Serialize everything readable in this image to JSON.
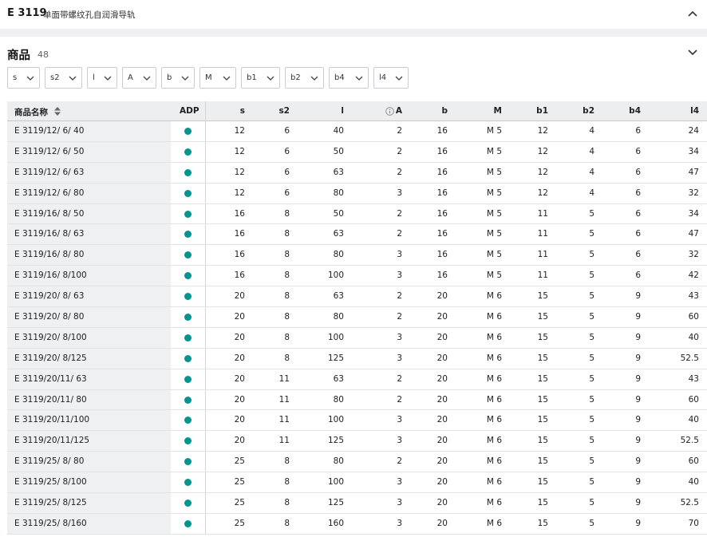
{
  "header": {
    "code": "E 3119",
    "description": "单面带螺纹孔自润滑导轨"
  },
  "section": {
    "title": "商品",
    "count": "48"
  },
  "filters": [
    "s",
    "s2",
    "l",
    "A",
    "b",
    "M",
    "b1",
    "b2",
    "b4",
    "l4"
  ],
  "table": {
    "columns": [
      "商品名称",
      "ADP",
      "s",
      "s2",
      "l",
      "A",
      "b",
      "M",
      "b1",
      "b2",
      "b4",
      "l4"
    ],
    "rows": [
      [
        "E 3119/12/ 6/ 40",
        "12",
        "6",
        "40",
        "2",
        "16",
        "M 5",
        "12",
        "4",
        "6",
        "24"
      ],
      [
        "E 3119/12/ 6/ 50",
        "12",
        "6",
        "50",
        "2",
        "16",
        "M 5",
        "12",
        "4",
        "6",
        "34"
      ],
      [
        "E 3119/12/ 6/ 63",
        "12",
        "6",
        "63",
        "2",
        "16",
        "M 5",
        "12",
        "4",
        "6",
        "47"
      ],
      [
        "E 3119/12/ 6/ 80",
        "12",
        "6",
        "80",
        "3",
        "16",
        "M 5",
        "12",
        "4",
        "6",
        "32"
      ],
      [
        "E 3119/16/ 8/ 50",
        "16",
        "8",
        "50",
        "2",
        "16",
        "M 5",
        "11",
        "5",
        "6",
        "34"
      ],
      [
        "E 3119/16/ 8/ 63",
        "16",
        "8",
        "63",
        "2",
        "16",
        "M 5",
        "11",
        "5",
        "6",
        "47"
      ],
      [
        "E 3119/16/ 8/ 80",
        "16",
        "8",
        "80",
        "3",
        "16",
        "M 5",
        "11",
        "5",
        "6",
        "32"
      ],
      [
        "E 3119/16/ 8/100",
        "16",
        "8",
        "100",
        "3",
        "16",
        "M 5",
        "11",
        "5",
        "6",
        "42"
      ],
      [
        "E 3119/20/ 8/ 63",
        "20",
        "8",
        "63",
        "2",
        "20",
        "M 6",
        "15",
        "5",
        "9",
        "43"
      ],
      [
        "E 3119/20/ 8/ 80",
        "20",
        "8",
        "80",
        "2",
        "20",
        "M 6",
        "15",
        "5",
        "9",
        "60"
      ],
      [
        "E 3119/20/ 8/100",
        "20",
        "8",
        "100",
        "3",
        "20",
        "M 6",
        "15",
        "5",
        "9",
        "40"
      ],
      [
        "E 3119/20/ 8/125",
        "20",
        "8",
        "125",
        "3",
        "20",
        "M 6",
        "15",
        "5",
        "9",
        "52.5"
      ],
      [
        "E 3119/20/11/ 63",
        "20",
        "11",
        "63",
        "2",
        "20",
        "M 6",
        "15",
        "5",
        "9",
        "43"
      ],
      [
        "E 3119/20/11/ 80",
        "20",
        "11",
        "80",
        "2",
        "20",
        "M 6",
        "15",
        "5",
        "9",
        "60"
      ],
      [
        "E 3119/20/11/100",
        "20",
        "11",
        "100",
        "3",
        "20",
        "M 6",
        "15",
        "5",
        "9",
        "40"
      ],
      [
        "E 3119/20/11/125",
        "20",
        "11",
        "125",
        "3",
        "20",
        "M 6",
        "15",
        "5",
        "9",
        "52.5"
      ],
      [
        "E 3119/25/ 8/ 80",
        "25",
        "8",
        "80",
        "2",
        "20",
        "M 6",
        "15",
        "5",
        "9",
        "60"
      ],
      [
        "E 3119/25/ 8/100",
        "25",
        "8",
        "100",
        "3",
        "20",
        "M 6",
        "15",
        "5",
        "9",
        "40"
      ],
      [
        "E 3119/25/ 8/125",
        "25",
        "8",
        "125",
        "3",
        "20",
        "M 6",
        "15",
        "5",
        "9",
        "52.5"
      ],
      [
        "E 3119/25/ 8/160",
        "25",
        "8",
        "160",
        "3",
        "20",
        "M 6",
        "15",
        "5",
        "9",
        "70"
      ]
    ]
  },
  "icons": {
    "collapse": "chevron-up-icon",
    "expand": "chevron-down-icon",
    "dropdown": "chevron-down-icon",
    "sort": "sort-icon",
    "info": "info-icon",
    "adp_status": "status-dot-icon"
  },
  "colors": {
    "adp_dot": "#00958f",
    "header_bg": "#eceef0",
    "separator": "#eef0f2"
  }
}
